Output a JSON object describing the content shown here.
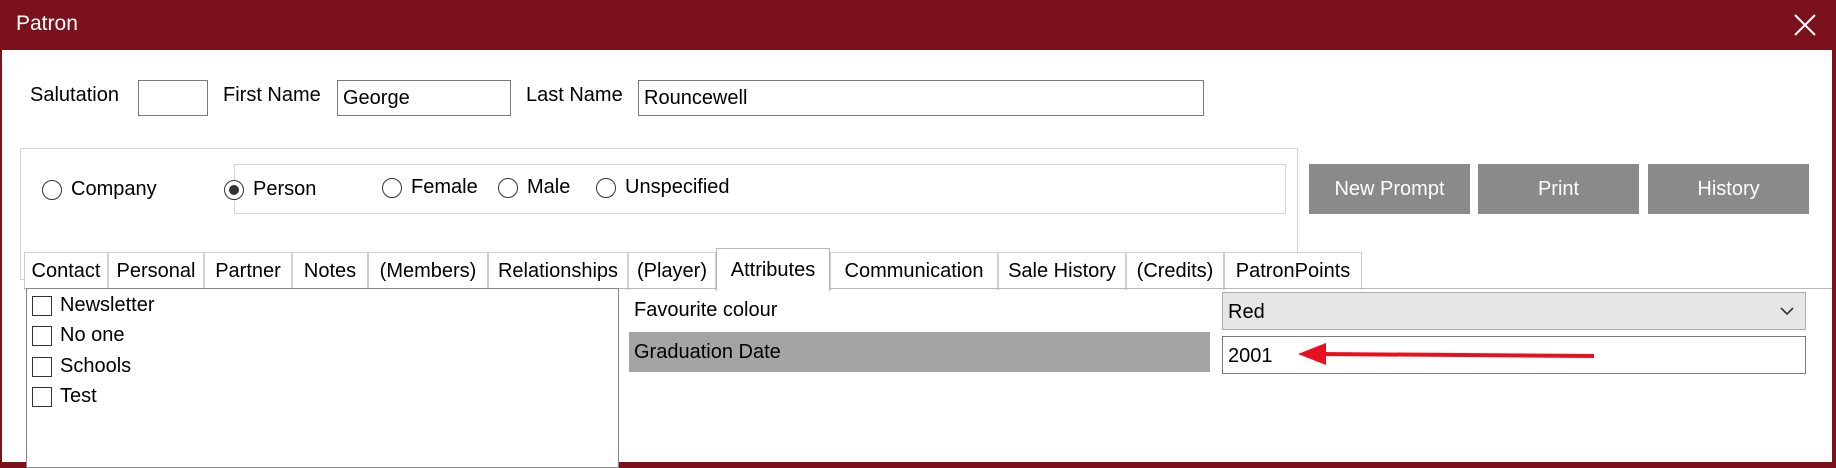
{
  "window": {
    "title": "Patron",
    "close_icon": "close-icon"
  },
  "name_row": {
    "salutation_label": "Salutation",
    "salutation_value": "",
    "first_name_label": "First Name",
    "first_name_value": "George",
    "last_name_label": "Last Name",
    "last_name_value": "Rouncewell"
  },
  "patron_type": {
    "company_label": "Company",
    "person_label": "Person",
    "selected": "Person"
  },
  "gender": {
    "female_label": "Female",
    "male_label": "Male",
    "unspecified_label": "Unspecified",
    "selected": ""
  },
  "buttons": {
    "new_prompt": "New Prompt",
    "print": "Print",
    "history": "History"
  },
  "tabs": [
    {
      "label": "Contact"
    },
    {
      "label": "Personal"
    },
    {
      "label": "Partner"
    },
    {
      "label": "Notes"
    },
    {
      "label": "(Members)"
    },
    {
      "label": "Relationships"
    },
    {
      "label": "(Player)"
    },
    {
      "label": "Attributes",
      "active": true
    },
    {
      "label": "Communication"
    },
    {
      "label": "Sale History"
    },
    {
      "label": "(Credits)"
    },
    {
      "label": "PatronPoints"
    }
  ],
  "attributes": {
    "checklist": [
      {
        "label": "Newsletter",
        "checked": false
      },
      {
        "label": "No one",
        "checked": false
      },
      {
        "label": "Schools",
        "checked": false
      },
      {
        "label": "Test",
        "checked": false
      }
    ],
    "favourite_colour_label": "Favourite colour",
    "favourite_colour_value": "Red",
    "graduation_date_label": "Graduation Date",
    "graduation_date_value": "2001"
  },
  "colors": {
    "titlebar": "#7a111b",
    "button_gray": "#8a8a8a",
    "highlight_row": "#a4a4a4",
    "annotation_arrow": "#e8101e"
  }
}
